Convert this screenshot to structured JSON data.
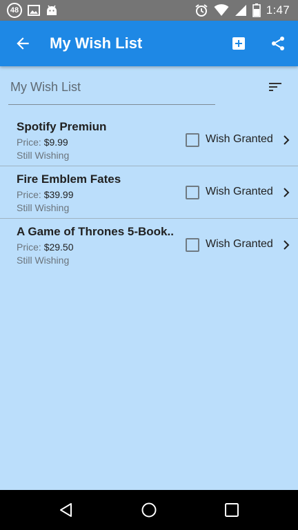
{
  "status_bar": {
    "notification_count": "48",
    "time": "1:47",
    "left_icons": [
      "notification-count-icon",
      "image-icon",
      "android-icon"
    ],
    "right_icons": [
      "alarm-icon",
      "wifi-icon",
      "signal-icon",
      "battery-icon"
    ]
  },
  "app_bar": {
    "title": "My Wish List",
    "color": "#1e88e5",
    "actions": [
      "arrow-back-icon",
      "add-box-icon",
      "share-icon"
    ]
  },
  "list_header": {
    "name_value": "My Wish List",
    "sort_icon": "sort-icon"
  },
  "items": [
    {
      "name": "Spotify Premiun",
      "price_label": "Price:",
      "price": "$9.99",
      "status": "Still Wishing",
      "granted_label": "Wish Granted",
      "granted": false
    },
    {
      "name": "Fire Emblem Fates",
      "price_label": "Price:",
      "price": "$39.99",
      "status": "Still Wishing",
      "granted_label": "Wish Granted",
      "granted": false
    },
    {
      "name": "A Game of Thrones 5-Book..",
      "price_label": "Price:",
      "price": "$29.50",
      "status": "Still Wishing",
      "granted_label": "Wish Granted",
      "granted": false
    }
  ],
  "colors": {
    "background": "#bbdefb",
    "status_bar": "#757575",
    "nav_bar": "#000000"
  },
  "nav_bar": {
    "buttons": [
      "nav-back-icon",
      "nav-home-icon",
      "nav-recents-icon"
    ]
  }
}
